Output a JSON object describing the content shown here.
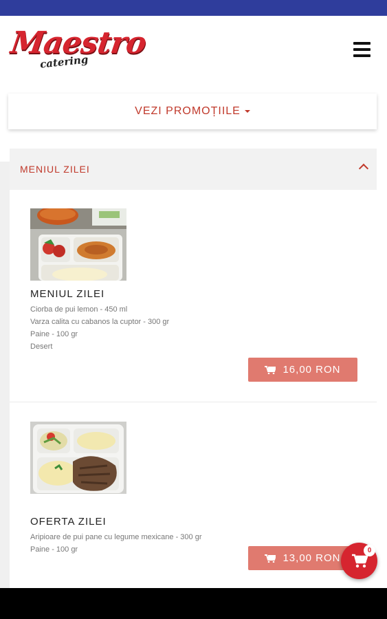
{
  "brand": {
    "name": "Maestro",
    "tagline": "catering"
  },
  "promotions": {
    "label": "VEZI PROMOȚIILE"
  },
  "category": {
    "label": "MENIUL ZILEI"
  },
  "products": [
    {
      "title": "MENIUL ZILEI",
      "lines": [
        "Ciorba de pui lemon - 450 ml",
        "Varza calita cu cabanos la cuptor - 300 gr",
        "Paine - 100 gr",
        "Desert"
      ],
      "price": "16,00 RON"
    },
    {
      "title": "OFERTA ZILEI",
      "lines": [
        "Aripioare de pui pane cu legume mexicane - 300 gr",
        "Paine - 100 gr"
      ],
      "price": "13,00 RON"
    }
  ],
  "cart": {
    "count": "0"
  },
  "colors": {
    "accent": "#d6252f",
    "price_button": "#e07a6f",
    "status_bar": "#2f3d9c"
  }
}
